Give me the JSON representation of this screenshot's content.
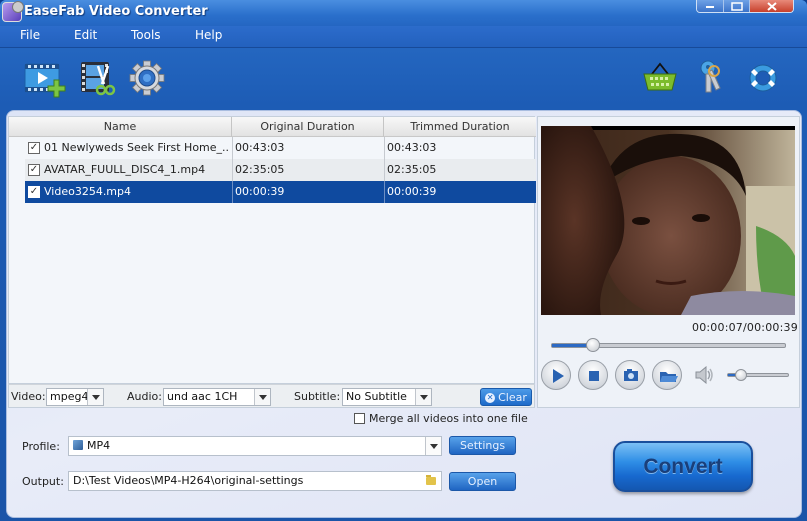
{
  "window": {
    "title": "EaseFab Video Converter",
    "controls": [
      "minimize",
      "maximize",
      "close"
    ]
  },
  "menu": [
    "File",
    "Edit",
    "Tools",
    "Help"
  ],
  "toolbar": {
    "left": [
      {
        "name": "add-video",
        "icon": "film-plus-icon"
      },
      {
        "name": "edit-video",
        "icon": "film-scissors-icon"
      },
      {
        "name": "settings",
        "icon": "gear-icon"
      }
    ],
    "right": [
      {
        "name": "buy",
        "icon": "basket-icon"
      },
      {
        "name": "register",
        "icon": "keys-icon"
      },
      {
        "name": "help",
        "icon": "lifebuoy-icon"
      }
    ]
  },
  "table": {
    "columns": [
      "Name",
      "Original Duration",
      "Trimmed Duration"
    ],
    "rows": [
      {
        "checked": true,
        "name": "01 Newlyweds Seek First Home_...",
        "original": "00:43:03",
        "trimmed": "00:43:03",
        "selected": false
      },
      {
        "checked": true,
        "name": "AVATAR_FUULL_DISC4_1.mp4",
        "original": "02:35:05",
        "trimmed": "02:35:05",
        "selected": false
      },
      {
        "checked": true,
        "name": "Video3254.mp4",
        "original": "00:00:39",
        "trimmed": "00:00:39",
        "selected": true
      }
    ]
  },
  "options": {
    "video_label": "Video:",
    "video_value": "mpeg4",
    "audio_label": "Audio:",
    "audio_value": "und aac 1CH",
    "subtitle_label": "Subtitle:",
    "subtitle_value": "No Subtitle",
    "clear_label": "Clear"
  },
  "merge": {
    "label": "Merge all videos into one file",
    "checked": false
  },
  "profile": {
    "label": "Profile:",
    "value": "MP4",
    "settings_label": "Settings"
  },
  "output": {
    "label": "Output:",
    "value": "D:\\Test Videos\\MP4-H264\\original-settings",
    "open_label": "Open"
  },
  "preview": {
    "time": "00:00:07/00:00:39",
    "progress_fraction": 0.18,
    "volume_fraction": 0.22,
    "controls": [
      "play",
      "stop",
      "snapshot",
      "open-folder",
      "volume"
    ]
  },
  "convert_label": "Convert"
}
